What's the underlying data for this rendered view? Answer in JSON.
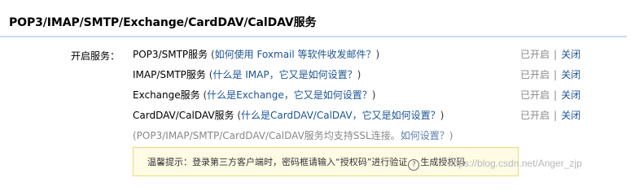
{
  "header": {
    "title": "POP3/IMAP/SMTP/Exchange/CardDAV/CalDAV服务"
  },
  "label": "开启服务：",
  "services": [
    {
      "name": "POP3/SMTP服务",
      "open": " (",
      "help": "如何使用 Foxmail 等软件收发邮件？",
      "close": ")",
      "status": "已开启",
      "sep": "|",
      "action": "关闭"
    },
    {
      "name": "IMAP/SMTP服务",
      "open": " (",
      "help": "什么是 IMAP，它又是如何设置？",
      "close": ")",
      "status": "已开启",
      "sep": "|",
      "action": "关闭"
    },
    {
      "name": "Exchange服务",
      "open": " (",
      "help": "什么是Exchange，它又是如何设置？",
      "close": ")",
      "status": "已开启",
      "sep": "|",
      "action": "关闭"
    },
    {
      "name": "CardDAV/CalDAV服务",
      "open": " (",
      "help": "什么是CardDAV/CalDAV，它又是如何设置？",
      "close": ")",
      "status": "已开启",
      "sep": "|",
      "action": "关闭"
    }
  ],
  "ssl_note": {
    "text": "(POP3/IMAP/SMTP/CardDAV/CalDAV服务均支持SSL连接。",
    "link": "如何设置？",
    "end": ")"
  },
  "tip": {
    "prefix": "温馨提示：登录第三方客户端时，密码框请输入“授权码”进行验证",
    "help_glyph": "?",
    "link": "生成授权码"
  },
  "watermark": "https://blog.csdn.net/Anger_zjp",
  "colors": {
    "link": "#1d5494",
    "tip_bg": "#fffbe5",
    "tip_border": "#f2d879",
    "rule": "#c8daf0"
  }
}
